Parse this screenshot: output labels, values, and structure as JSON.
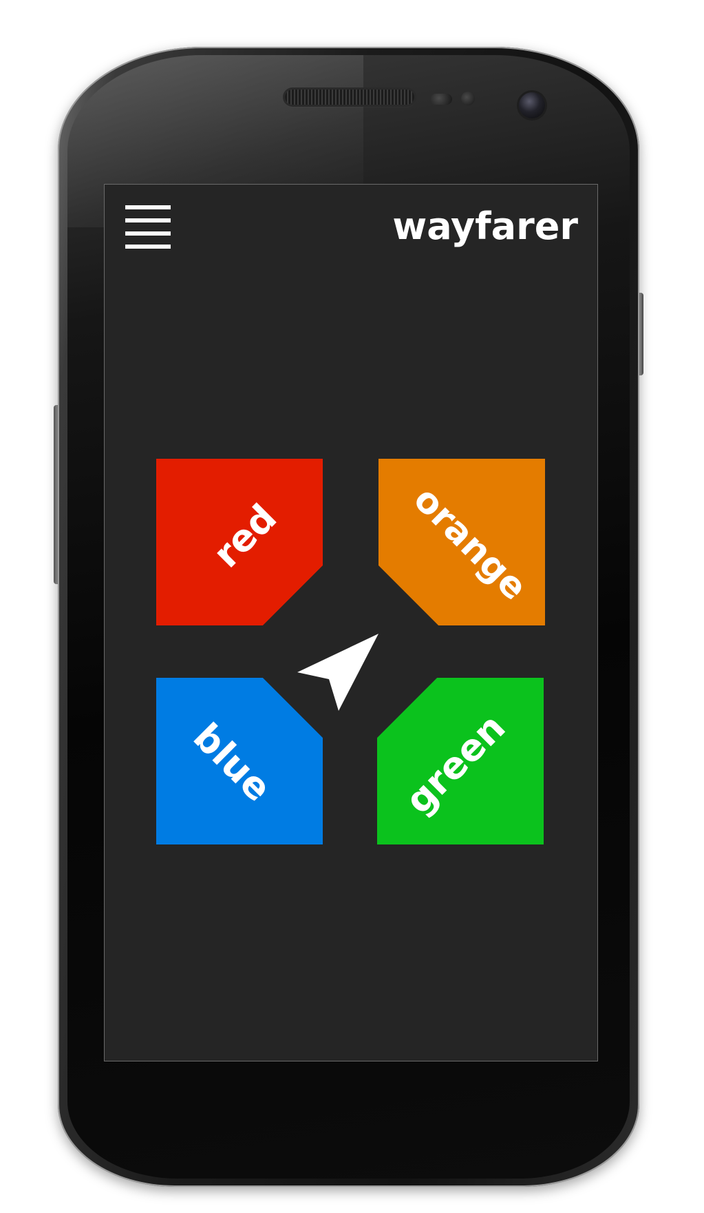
{
  "app": {
    "title": "wayfarer"
  },
  "toolbar": {
    "menu_icon": "hamburger-menu-icon"
  },
  "tiles": [
    {
      "label": "red",
      "color": "#e31d00"
    },
    {
      "label": "orange",
      "color": "#e47c00"
    },
    {
      "label": "blue",
      "color": "#007ce3"
    },
    {
      "label": "green",
      "color": "#0bc21d"
    }
  ],
  "center": {
    "icon": "navigation-arrow-icon",
    "color": "#ffffff"
  },
  "device": {
    "screen_background": "#252525"
  }
}
